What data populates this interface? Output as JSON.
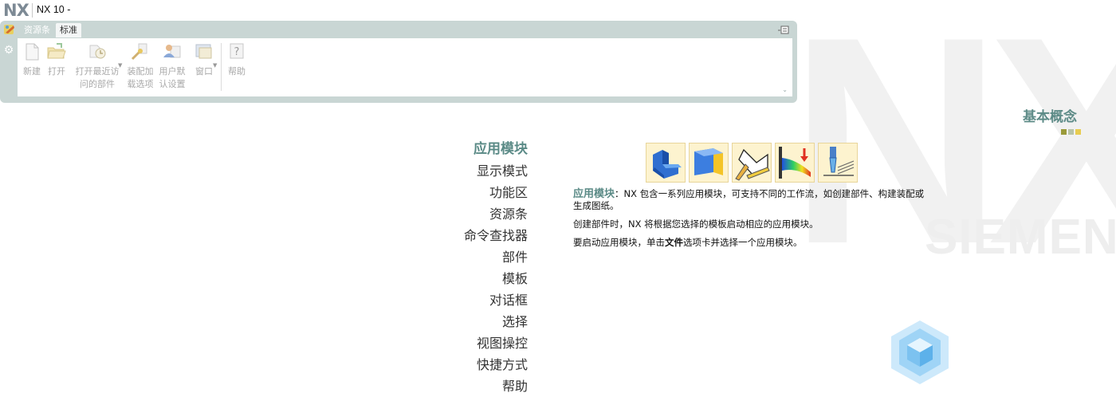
{
  "app": {
    "logo": "NX",
    "title": "NX 10 -"
  },
  "watermark": {
    "big": "NX",
    "brand": "SIEMEN"
  },
  "ribbon": {
    "tabs": [
      {
        "label": "资源条",
        "active": false
      },
      {
        "label": "标准",
        "active": true
      }
    ],
    "buttons": [
      {
        "line1": "新建",
        "line2": "",
        "icon": "new-file-icon"
      },
      {
        "line1": "打开",
        "line2": "",
        "icon": "open-folder-icon"
      },
      {
        "line1": "打开最近访",
        "line2": "问的部件",
        "icon": "recent-parts-icon"
      },
      {
        "line1": "装配加",
        "line2": "载选项",
        "icon": "assembly-load-icon"
      },
      {
        "line1": "用户默",
        "line2": "认设置",
        "icon": "user-defaults-icon"
      },
      {
        "line1": "窗口",
        "line2": "",
        "icon": "window-icon"
      },
      {
        "line1": "帮助",
        "line2": "",
        "icon": "help-icon"
      }
    ]
  },
  "corner": {
    "label": "基本概念",
    "colors": [
      "#9a9a3a",
      "#b8c4a8",
      "#e8cc50"
    ]
  },
  "nav": {
    "title": "应用模块",
    "items": [
      "显示模式",
      "功能区",
      "资源条",
      "命令查找器",
      "部件",
      "模板",
      "对话框",
      "选择",
      "视图操控",
      "快捷方式",
      "帮助"
    ]
  },
  "modules": [
    {
      "icon": "modeling-block-icon"
    },
    {
      "icon": "shape-studio-icon"
    },
    {
      "icon": "drafting-icon"
    },
    {
      "icon": "simulation-icon"
    },
    {
      "icon": "manufacturing-icon"
    }
  ],
  "description": {
    "heading": "应用模块",
    "p1": "：NX 包含一系列应用模块，可支持不同的工作流，如创建部件、构建装配或生成图纸。",
    "p2": "创建部件时，NX 将根据您选择的模板启动相应的应用模块。",
    "p3_before": "要启动应用模块，单击",
    "p3_bold": "文件",
    "p3_after": "选项卡并选择一个应用模块。"
  }
}
